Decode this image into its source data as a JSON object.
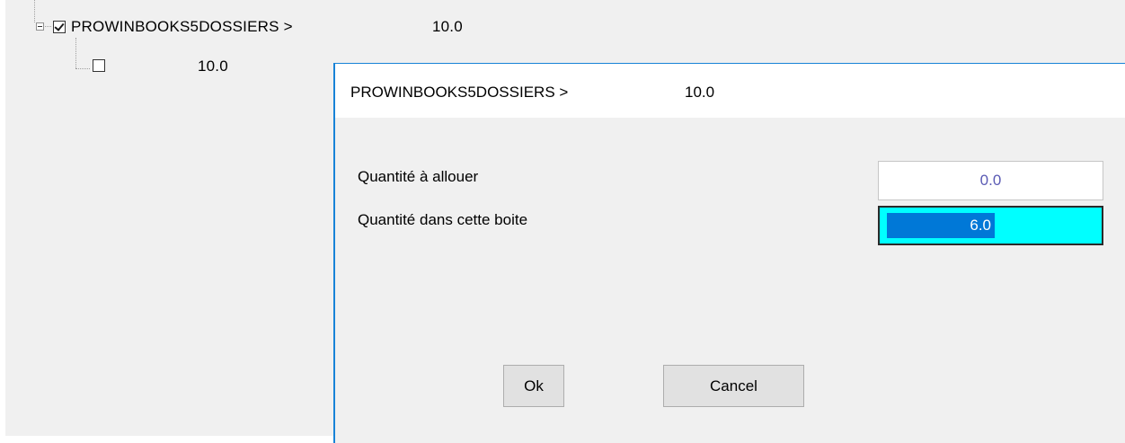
{
  "tree": {
    "root": {
      "label": "PROWINBOOKS5DOSSIERS >",
      "quantity": "10.0",
      "checked": true,
      "expanded": true
    },
    "child": {
      "label": "",
      "quantity": "10.0",
      "checked": false
    }
  },
  "dialog": {
    "title": {
      "name": "PROWINBOOKS5DOSSIERS >",
      "quantity": "10.0"
    },
    "fields": {
      "allocate": {
        "label": "Quantité à allouer",
        "value": "0.0"
      },
      "box_quantity": {
        "label": "Quantité dans cette boite",
        "value": "6.0"
      }
    },
    "buttons": {
      "ok": "Ok",
      "cancel": "Cancel"
    }
  },
  "colors": {
    "dialog_border": "#1883d7",
    "active_field_bg": "#00ffff",
    "selection": "#0078d7",
    "readonly_value": "#5a5ab4"
  }
}
